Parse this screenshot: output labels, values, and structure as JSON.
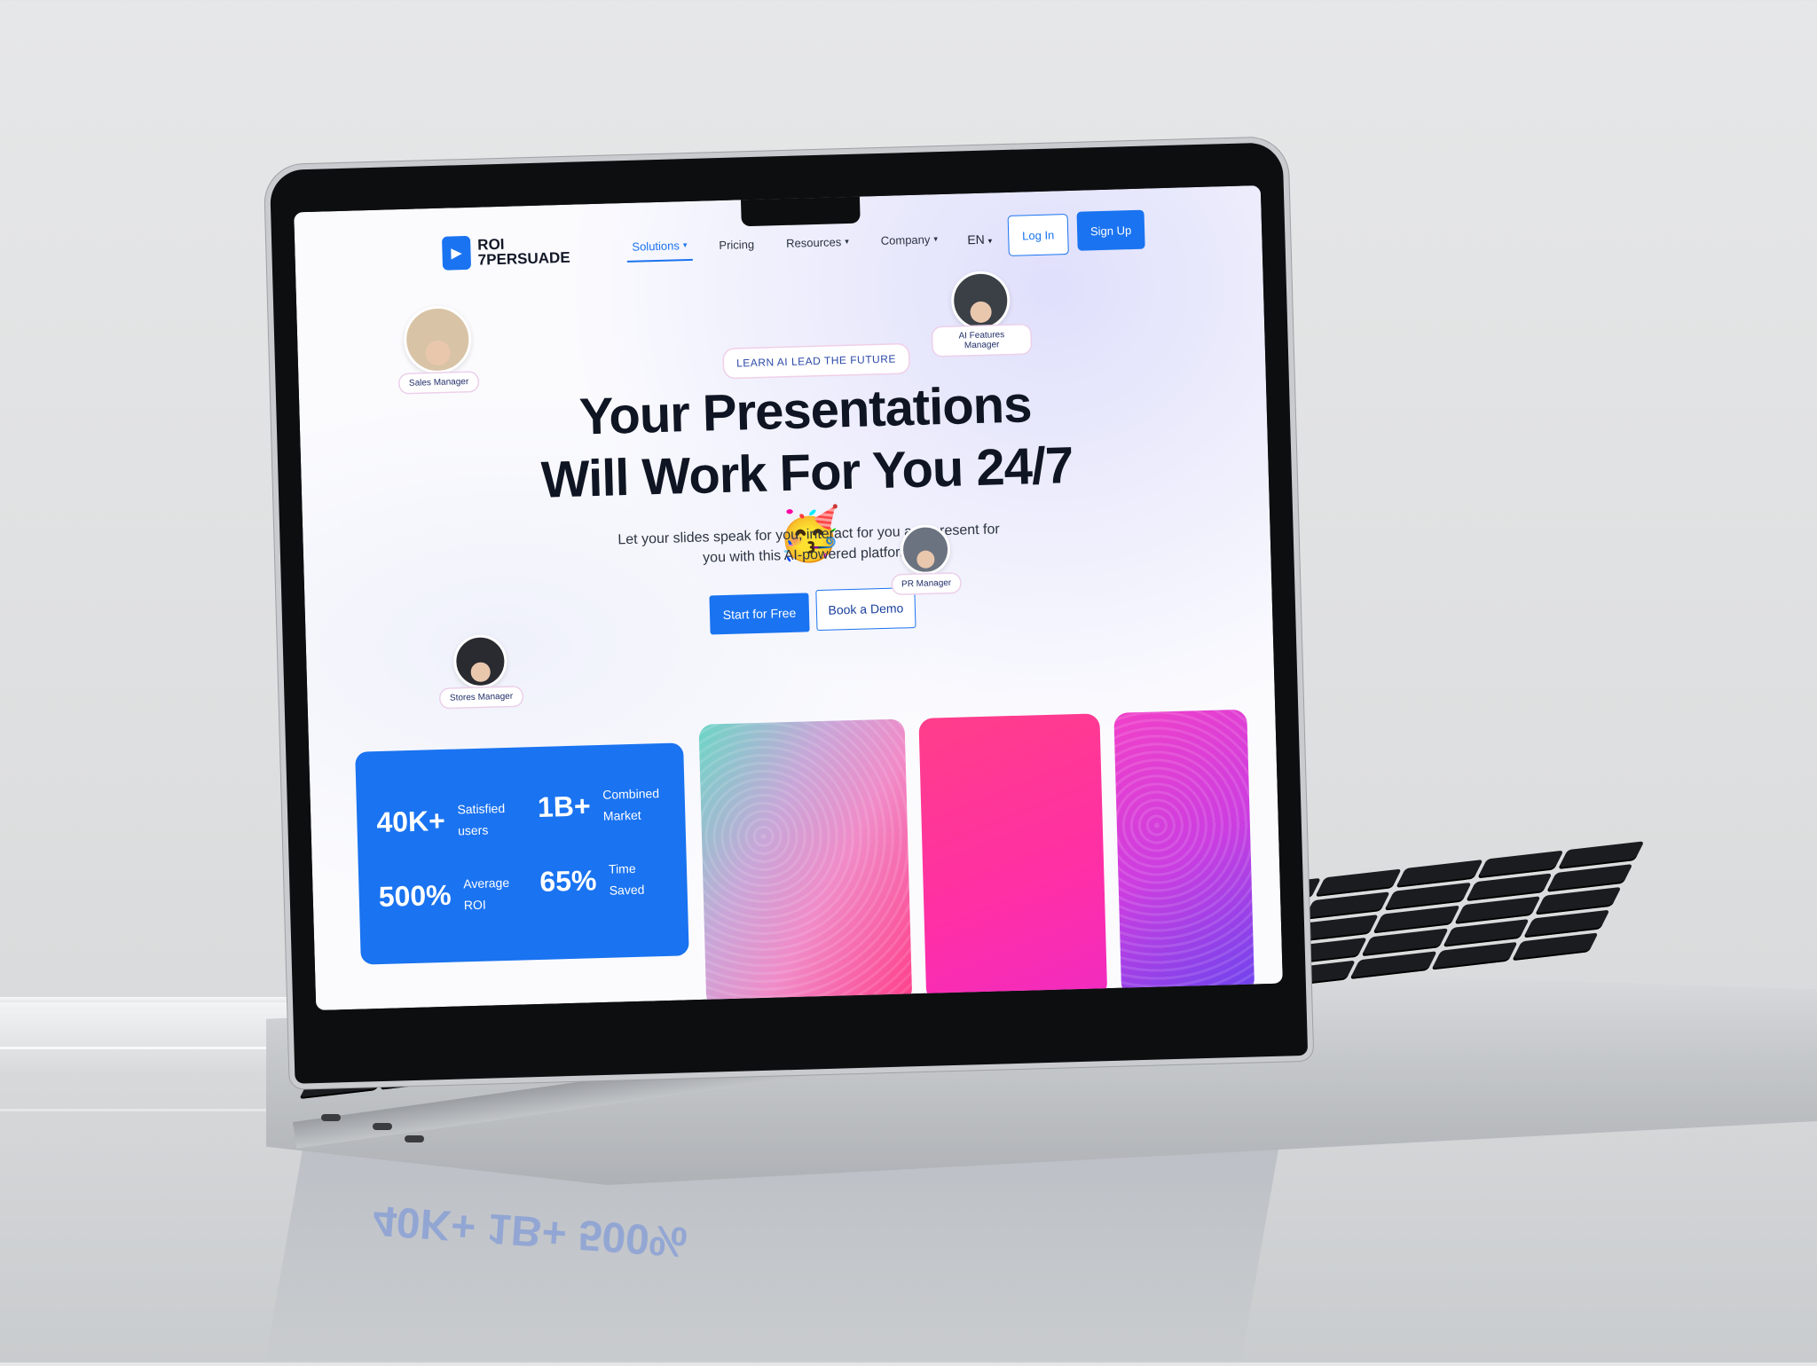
{
  "brand": {
    "line1": "ROI",
    "line2": "7PERSUADE",
    "accent": "#1a73f0"
  },
  "nav": {
    "items": [
      {
        "label": "Solutions",
        "dropdown": true,
        "active": true
      },
      {
        "label": "Pricing",
        "dropdown": false,
        "active": false
      },
      {
        "label": "Resources",
        "dropdown": true,
        "active": false
      },
      {
        "label": "Company",
        "dropdown": true,
        "active": false
      }
    ],
    "language": "EN",
    "login_label": "Log In",
    "signup_label": "Sign Up"
  },
  "hero": {
    "eyebrow": "LEARN AI LEAD THE FUTURE",
    "headline": "Your Presentations Will Work For You 24/7 🥳",
    "subtext": "Let your slides speak for you, interact for you and present for you with this AI-powered platform.",
    "primary_cta": "Start for Free",
    "secondary_cta": "Book a Demo"
  },
  "people": [
    {
      "role": "Sales Manager"
    },
    {
      "role": "AI Features Manager"
    },
    {
      "role": "PR Manager"
    },
    {
      "role": "Stores Manager"
    }
  ],
  "stats": [
    {
      "value": "40K+",
      "label": "Satisfied users"
    },
    {
      "value": "1B+",
      "label": "Combined Market"
    },
    {
      "value": "500%",
      "label": "Average ROI"
    },
    {
      "value": "65%",
      "label": "Time Saved"
    }
  ],
  "reflection": {
    "text": "40K+  1B+  500%"
  }
}
